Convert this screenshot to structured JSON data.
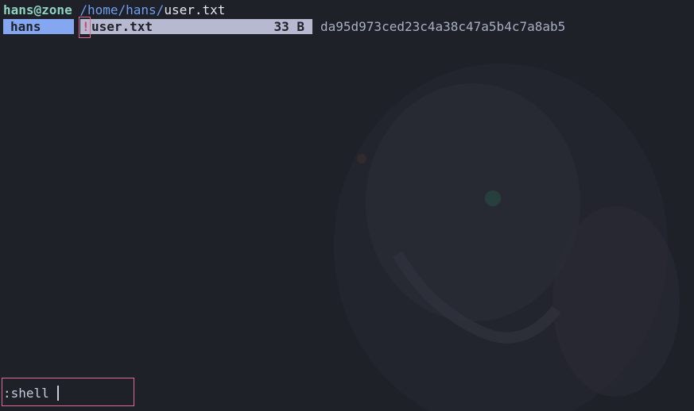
{
  "prompt": {
    "user_host": "hans@zone",
    "dir": "/home/hans/",
    "file": "user.txt"
  },
  "columns": {
    "parent": {
      "label": "hans"
    },
    "current": {
      "mark": "!",
      "filename": "user.txt",
      "size": "33 B"
    }
  },
  "preview": {
    "content": "da95d973ced23c4a38c47a5b4c7a8ab5"
  },
  "command_line": {
    "value": ":shell "
  },
  "colors": {
    "background": "#1f2129",
    "parent_highlight": "#85a7f2",
    "selection_highlight": "#b6b9d0",
    "accent_box": "#e46a94",
    "user_host": "#8fd3c1",
    "directory": "#6f9df0"
  }
}
